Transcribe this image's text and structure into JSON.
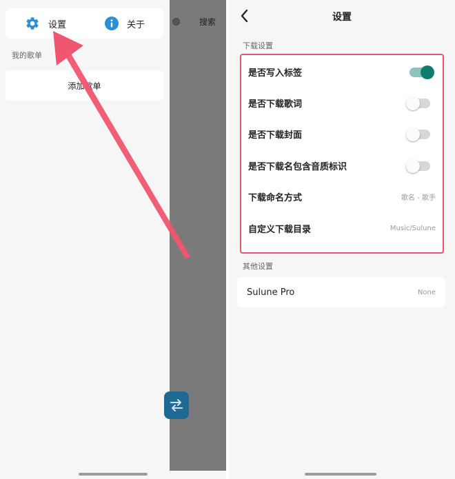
{
  "left": {
    "menu": {
      "settings_label": "设置",
      "about_label": "关于"
    },
    "section_label": "我的歌单",
    "add_playlist_label": "添加歌单",
    "behind_search_label": "搜索"
  },
  "right": {
    "title": "设置",
    "download_section_label": "下载设置",
    "download_settings": [
      {
        "label": "是否写入标签",
        "type": "toggle",
        "on": true
      },
      {
        "label": "是否下载歌词",
        "type": "toggle",
        "on": false
      },
      {
        "label": "是否下载封面",
        "type": "toggle",
        "on": false
      },
      {
        "label": "是否下载名包含音质标识",
        "type": "toggle",
        "on": false
      },
      {
        "label": "下载命名方式",
        "type": "value",
        "value": "歌名 - 歌手"
      },
      {
        "label": "自定义下载目录",
        "type": "value",
        "value": "Music/Sulune"
      }
    ],
    "other_section_label": "其他设置",
    "other_settings": [
      {
        "label": "Sulune Pro",
        "value": "None"
      }
    ]
  },
  "colors": {
    "accent_teal": "#0e7e6c",
    "highlight_red": "#e0566f",
    "icon_blue": "#2d8fd5"
  },
  "icons": {
    "settings": "gear-icon",
    "about": "info-icon",
    "back": "chevron-left-icon",
    "swap": "swap-arrows-icon"
  }
}
